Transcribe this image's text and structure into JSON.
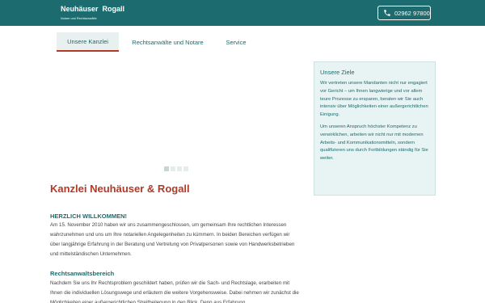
{
  "brand": {
    "name_left": "Neuhäuser",
    "name_right": "Rogall",
    "subtitle": "Notare und Rechtsanwälte"
  },
  "header": {
    "phone": "02962 97800",
    "phone_icon": "phone-icon"
  },
  "nav": {
    "items": [
      {
        "label": "Unsere Kanzlei",
        "active": true
      },
      {
        "label": "Rechtsanwälte und Notare",
        "active": false
      },
      {
        "label": "Service",
        "active": false
      }
    ]
  },
  "slider": {
    "total": 4,
    "active_index": 0
  },
  "sidebar": {
    "title": "Unsere Ziele",
    "paragraphs": [
      "Wir vertreten unsere Mandanten nicht nur engagiert vor Gericht – um Ihnen langwierige und vor allem teure Prozesse zu ersparen, beraten wir Sie auch intensiv über Möglichkeiten einer außergerichtlichen Einigung.",
      "Um unseren Anspruch höchster Kompetenz zu verwirklichen, arbeiten wir nicht nur mit modernen Arbeits- und Kommunikationsmitteln, sondern qualifizieren uns durch Fortbildungen ständig für Sie weiter."
    ]
  },
  "main": {
    "title": "Kanzlei Neuhäuser & Rogall",
    "welcome_heading": "HERZLICH WILLKOMMEN!",
    "welcome_text": "Am 15. November 2010 haben wir uns zusammengeschlossen, um gemeinsam Ihre rechtlichen Interessen wahrzunehmen und uns um Ihre notariellen Angelegenheiten zu kümmern. In beiden Bereichen verfügen wir über langjährige Erfahrung in der Beratung und Vertretung von Privatpersonen sowie von Handwerksbetrieben und mittelständischen Unternehmen.",
    "section_heading": "Rechtsanwaltsbereich",
    "section_text": "Nachdem Sie uns Ihr Rechtsproblem geschildert haben, prüfen wir die Sach- und Rechtslage, erarbeiten mit Ihnen die individuellen Lösungswege und erläutern die weitere Vorgehensweise. Dabei nehmen wir zunächst die Möglichkeiten einer außergerichtlichen Streitbeilegung in den Blick. Denn aus Erfahrung"
  },
  "colors": {
    "brand": "#1c6b6e",
    "accent": "#b03a28",
    "sidebar_bg": "#e8f3f3"
  }
}
